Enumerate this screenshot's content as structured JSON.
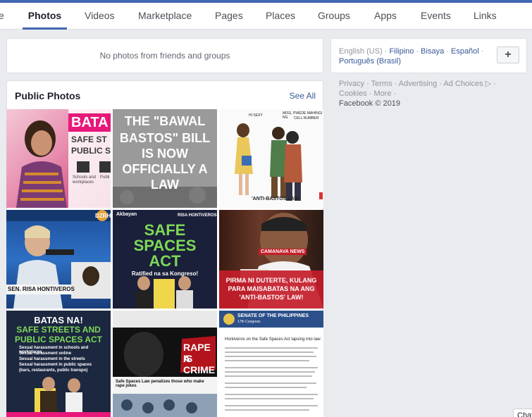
{
  "tabs": [
    {
      "label": "e"
    },
    {
      "label": "Photos"
    },
    {
      "label": "Videos"
    },
    {
      "label": "Marketplace"
    },
    {
      "label": "Pages"
    },
    {
      "label": "Places"
    },
    {
      "label": "Groups"
    },
    {
      "label": "Apps"
    },
    {
      "label": "Events"
    },
    {
      "label": "Links"
    }
  ],
  "no_photos_message": "No photos from friends and groups",
  "public_photos": {
    "title": "Public Photos",
    "see_all": "See All",
    "photos": [
      {
        "overlay": [
          "BATA",
          "SAFE ST",
          "PUBLIC S",
          "Schools and",
          "workplaces",
          "Publi"
        ]
      },
      {
        "overlay": [
          "THE \"BAWAL",
          "BASTOS\" BILL",
          "IS NOW",
          "OFFICIALLY A",
          "LAW"
        ]
      },
      {
        "overlay": [
          "'ANTI-BASTOS LAW'",
          "HI SEXY",
          "MISS, PWEDE MAHINGI NG",
          "CELL NUMBER"
        ]
      },
      {
        "overlay": [
          "SEN. RISA HONTIVEROS",
          "DZRH"
        ]
      },
      {
        "overlay": [
          "Akbayan",
          "RISA HONTIVEROS",
          "SAFE",
          "SPACES",
          "ACT",
          "Ratified na sa Kongreso!"
        ]
      },
      {
        "overlay": [
          "CAMANAVA NEWS",
          "PIRMA NI DUTERTE, KULANG",
          "PARA MAISABATAS NA ANG",
          "'ANTI-BASTOS' LAW!"
        ]
      },
      {
        "overlay": [
          "BATAS NA!",
          "SAFE STREETS AND",
          "PUBLIC SPACES ACT",
          "Sexual harassment in schools and workplaces",
          "Sexual harassment online",
          "Sexual harassment in the streets",
          "Sexual harassment in public spaces",
          "(bars, restaurants, public transpo)"
        ]
      },
      {
        "overlay": [
          "RAPE IS",
          "A CRIME",
          "Safe Spaces Law penalizes those who make rape jokes"
        ]
      },
      {
        "overlay": [
          "SENATE OF THE PHILIPPINES",
          "17th Congress",
          "Hontiveros on the Safe Spaces Act lapsing into law:"
        ]
      }
    ]
  },
  "languages": {
    "current": "English (US)",
    "others": [
      "Filipino",
      "Bisaya",
      "Español",
      "Português (Brasil)"
    ],
    "add_icon": "plus-icon"
  },
  "footer": {
    "links": [
      "Privacy",
      "Terms",
      "Advertising",
      "Ad Choices",
      "Cookies",
      "More"
    ],
    "copyright": "Facebook © 2019"
  },
  "chat_label": "Chat"
}
